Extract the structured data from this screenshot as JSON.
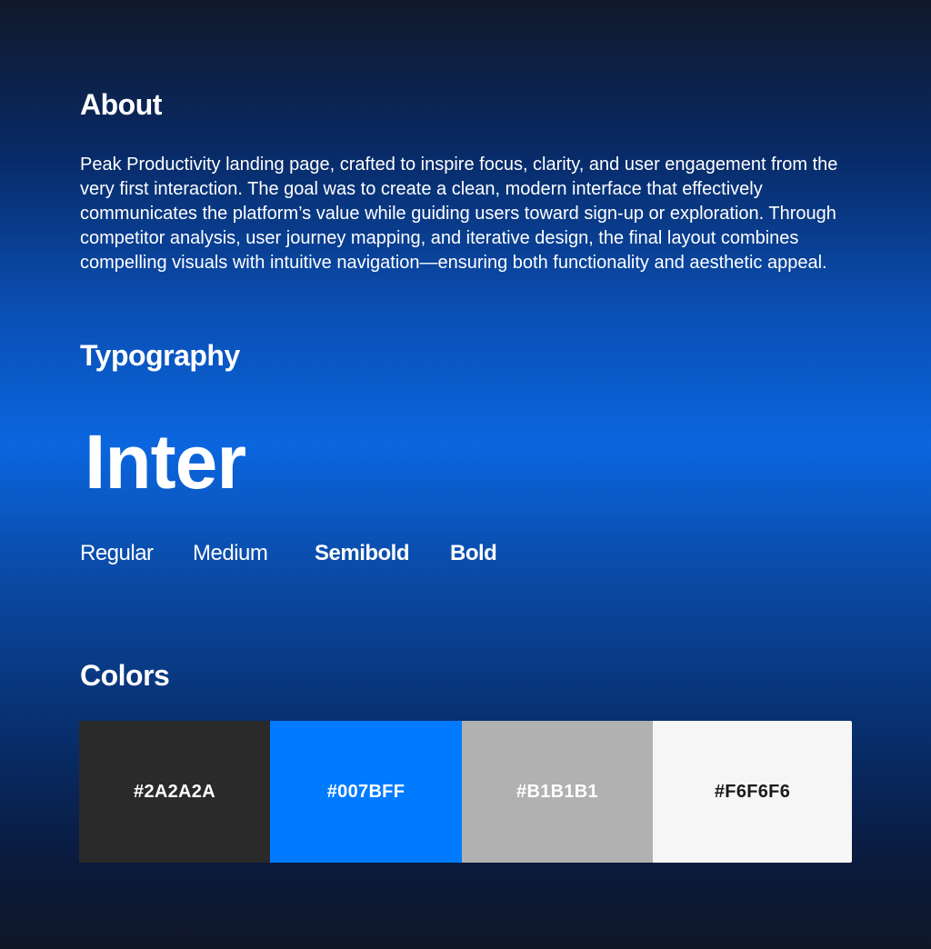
{
  "about": {
    "title": "About",
    "body": "Peak Productivity landing page, crafted to inspire focus, clarity, and user engagement from the very first interaction. The goal was to create a clean, modern interface that effectively communicates the platform’s value while guiding users toward sign-up or exploration. Through competitor analysis, user journey mapping, and iterative design, the final layout combines compelling visuals with intuitive navigation—ensuring both functionality and aesthetic appeal."
  },
  "typography": {
    "title": "Typography",
    "font_name": "Inter",
    "weights": [
      "Regular",
      "Medium",
      "Semibold",
      "Bold"
    ]
  },
  "colors": {
    "title": "Colors",
    "swatches": [
      {
        "label": "#2A2A2A",
        "hex": "#2A2A2A",
        "text_color": "#FFFFFF"
      },
      {
        "label": "#007BFF",
        "hex": "#007BFF",
        "text_color": "#FFFFFF"
      },
      {
        "label": "#B1B1B1",
        "hex": "#B1B1B1",
        "text_color": "#FFFFFF"
      },
      {
        "label": "#F6F6F6",
        "hex": "#F6F6F6",
        "text_color": "#1A1A1A"
      }
    ]
  }
}
